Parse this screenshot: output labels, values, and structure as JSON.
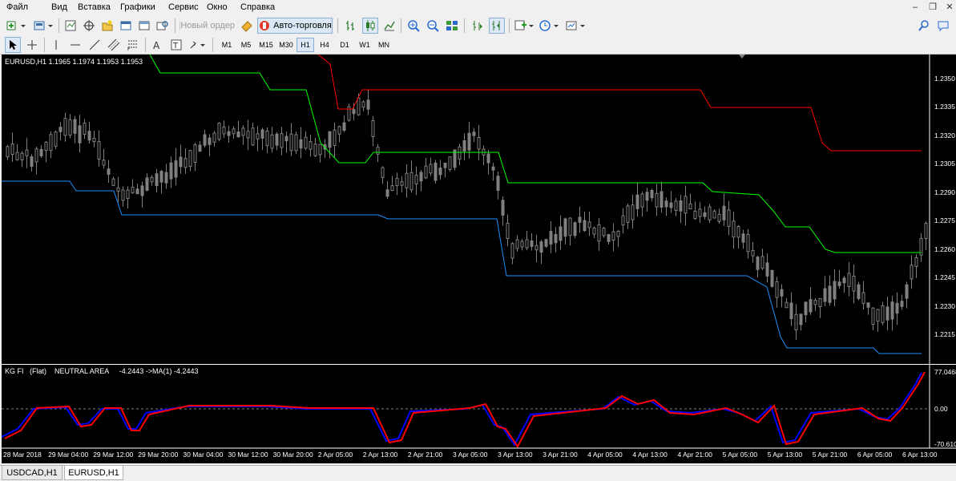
{
  "menu": {
    "items": [
      "Файл",
      "Вид",
      "Вставка",
      "Графики",
      "Сервис",
      "Окно",
      "Справка"
    ]
  },
  "toolbar": {
    "new_order_label": "Новый ордер",
    "autotrading_label": "Авто-торговля"
  },
  "timeframes": [
    "M1",
    "M5",
    "M15",
    "M30",
    "H1",
    "H4",
    "D1",
    "W1",
    "MN"
  ],
  "active_timeframe": "H1",
  "chart": {
    "symbol_info": "EURUSD,H1  1.1965 1.1974 1.1953 1.1953",
    "price_labels": [
      "1.2350",
      "1.2335",
      "1.2320",
      "1.2305",
      "1.2290",
      "1.2275",
      "1.2260",
      "1.2245",
      "1.2230",
      "1.2215"
    ],
    "background": "#000000",
    "candle_color": "#808080",
    "upper_line_color": "#ff0000",
    "middle_line_color": "#00ff00",
    "lower_line_color": "#1e90ff"
  },
  "indicator": {
    "name": "KG FI",
    "mode": "(Flat)",
    "area": "NEUTRAL AREA",
    "value_text": "-4.2443  ->MA(1) -4.2443",
    "scale_labels": [
      "77.0468",
      "0.00",
      "-70.6105"
    ],
    "line1_color": "#0000ff",
    "line2_color": "#ff0000"
  },
  "time_labels": [
    "28 Mar 2018",
    "29 Mar 04:00",
    "29 Mar 12:00",
    "29 Mar 20:00",
    "30 Mar 04:00",
    "30 Mar 12:00",
    "30 Mar 20:00",
    "2 Apr 05:00",
    "2 Apr 13:00",
    "2 Apr 21:00",
    "3 Apr 05:00",
    "3 Apr 13:00",
    "3 Apr 21:00",
    "4 Apr 05:00",
    "4 Apr 13:00",
    "4 Apr 21:00",
    "5 Apr 05:00",
    "5 Apr 13:00",
    "5 Apr 21:00",
    "6 Apr 05:00",
    "6 Apr 13:00"
  ],
  "tabs": [
    "USDCAD,H1",
    "EURUSD,H1"
  ],
  "active_tab": "EURUSD,H1"
}
